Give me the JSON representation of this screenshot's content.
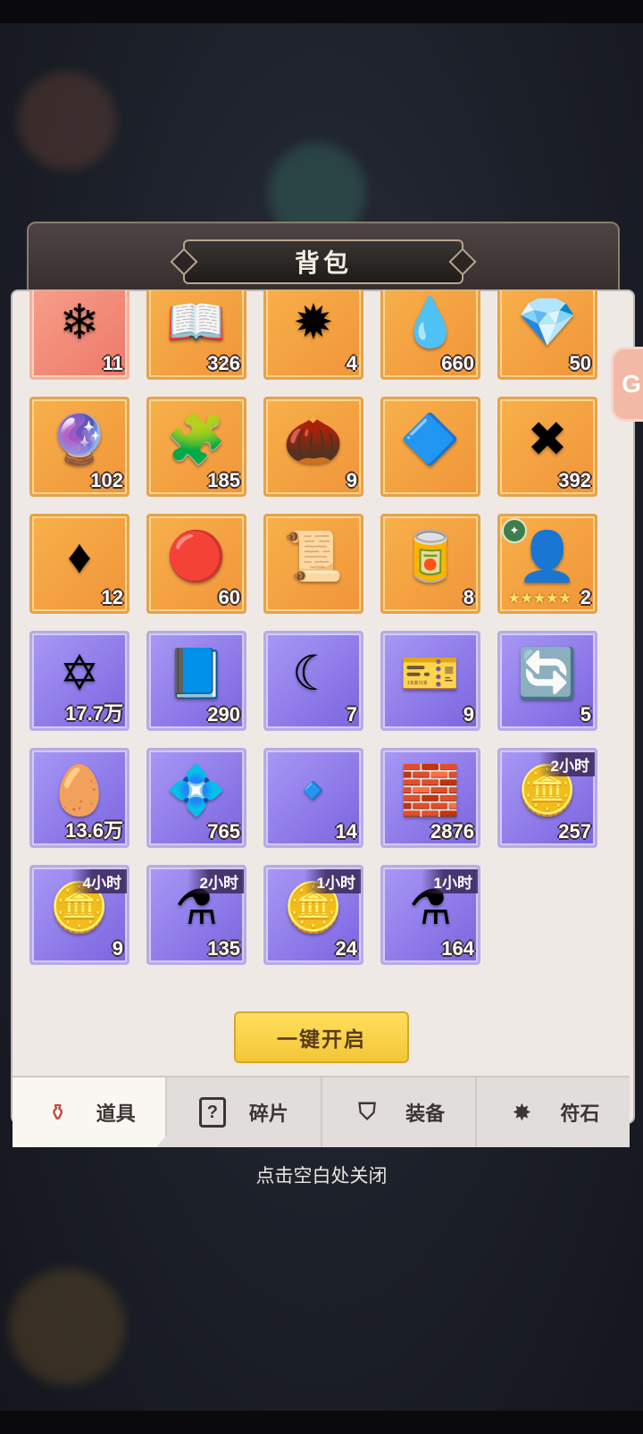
{
  "title": "背包",
  "items": [
    {
      "icon": "❄",
      "count": "11",
      "rarity": "pink"
    },
    {
      "icon": "📖",
      "count": "326",
      "rarity": "orange"
    },
    {
      "icon": "✹",
      "count": "4",
      "rarity": "orange"
    },
    {
      "icon": "💧",
      "count": "660",
      "rarity": "orange"
    },
    {
      "icon": "💎",
      "count": "50",
      "rarity": "orange"
    },
    {
      "icon": "🔮",
      "count": "102",
      "rarity": "orange"
    },
    {
      "icon": "🧩",
      "count": "185",
      "rarity": "orange"
    },
    {
      "icon": "🌰",
      "count": "9",
      "rarity": "orange"
    },
    {
      "icon": "🔷",
      "count": "",
      "rarity": "orange"
    },
    {
      "icon": "✖",
      "count": "392",
      "rarity": "orange"
    },
    {
      "icon": "♦",
      "count": "12",
      "rarity": "orange"
    },
    {
      "icon": "🔴",
      "count": "60",
      "rarity": "orange"
    },
    {
      "icon": "📜",
      "count": "",
      "rarity": "orange"
    },
    {
      "icon": "🥫",
      "count": "8",
      "rarity": "orange"
    },
    {
      "icon": "👤",
      "count": "2",
      "rarity": "orange",
      "stars": "★★★★★",
      "badge": "✦"
    },
    {
      "icon": "✡",
      "count": "17.7万",
      "rarity": "purple"
    },
    {
      "icon": "📘",
      "count": "290",
      "rarity": "purple"
    },
    {
      "icon": "☾",
      "count": "7",
      "rarity": "purple"
    },
    {
      "icon": "🎫",
      "count": "9",
      "rarity": "purple"
    },
    {
      "icon": "🔄",
      "count": "5",
      "rarity": "purple"
    },
    {
      "icon": "🥚",
      "count": "13.6万",
      "rarity": "purple"
    },
    {
      "icon": "💠",
      "count": "765",
      "rarity": "purple"
    },
    {
      "icon": "🔹",
      "count": "14",
      "rarity": "purple"
    },
    {
      "icon": "🧱",
      "count": "2876",
      "rarity": "purple"
    },
    {
      "icon": "🪙",
      "count": "257",
      "rarity": "purple",
      "timer": "2小时"
    },
    {
      "icon": "🪙",
      "count": "9",
      "rarity": "purple",
      "timer": "4小时"
    },
    {
      "icon": "⚗",
      "count": "135",
      "rarity": "purple",
      "timer": "2小时"
    },
    {
      "icon": "🪙",
      "count": "24",
      "rarity": "purple",
      "timer": "1小时"
    },
    {
      "icon": "⚗",
      "count": "164",
      "rarity": "purple",
      "timer": "1小时"
    }
  ],
  "open_all_label": "一键开启",
  "tabs": [
    {
      "label": "道具",
      "icon": "⚱",
      "active": true
    },
    {
      "label": "碎片",
      "icon": "?",
      "active": false
    },
    {
      "label": "装备",
      "icon": "⛉",
      "active": false
    },
    {
      "label": "符石",
      "icon": "✸",
      "active": false
    }
  ],
  "close_hint": "点击空白处关闭",
  "side_button_label": "G"
}
